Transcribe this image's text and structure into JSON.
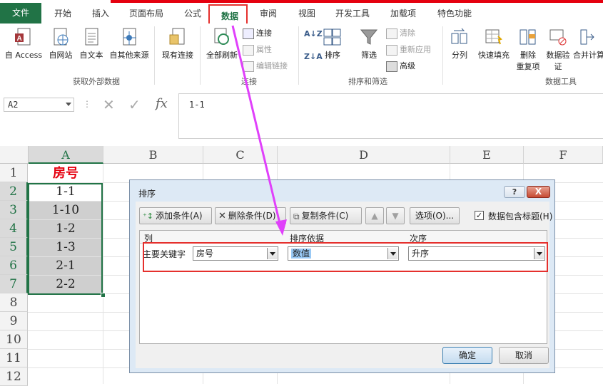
{
  "tabs": {
    "file": "文件",
    "items": [
      "开始",
      "插入",
      "页面布局",
      "公式",
      "数据",
      "审阅",
      "视图",
      "开发工具",
      "加载项",
      "特色功能"
    ],
    "active": "数据"
  },
  "ribbon": {
    "external": {
      "access": "自 Access",
      "web": "自网站",
      "text": "自文本",
      "other": "自其他来源",
      "existing": "现有连接",
      "group_label": "获取外部数据"
    },
    "connections": {
      "refresh_all": "全部刷新",
      "connections": "连接",
      "properties": "属性",
      "edit_links": "编辑链接",
      "group_label": "连接"
    },
    "sort_filter": {
      "sort_az": "A↓Z",
      "sort_za": "Z↓A",
      "sort": "排序",
      "filter": "筛选",
      "clear": "清除",
      "reapply": "重新应用",
      "advanced": "高级",
      "group_label": "排序和筛选"
    },
    "data_tools": {
      "split": "分列",
      "flash_fill": "快速填充",
      "remove_dup_1": "删除",
      "remove_dup_2": "重复项",
      "validation_1": "数据验",
      "validation_2": "证",
      "consolidate": "合并计算",
      "group_label": "数据工具"
    }
  },
  "formula_bar": {
    "name_box": "A2",
    "fx": "fx",
    "value": "1-1"
  },
  "sheet": {
    "columns": [
      "A",
      "B",
      "C",
      "D",
      "E",
      "F"
    ],
    "rows": [
      "1",
      "2",
      "3",
      "4",
      "5",
      "6",
      "7",
      "8",
      "9",
      "10",
      "11",
      "12"
    ],
    "column_a": [
      "房号",
      "1-1",
      "1-10",
      "1-2",
      "1-3",
      "2-1",
      "2-2"
    ]
  },
  "dialog": {
    "title": "排序",
    "help": "?",
    "close": "X",
    "add_level": "添加条件(A)",
    "delete_level": "删除条件(D)",
    "copy_level": "复制条件(C)",
    "options": "选项(O)...",
    "has_headers": "数据包含标题(H)",
    "has_headers_checked": true,
    "headers": {
      "column": "列",
      "sort_on": "排序依据",
      "order": "次序"
    },
    "row": {
      "label": "主要关键字",
      "column": "房号",
      "sort_on": "数值",
      "order": "升序"
    },
    "ok": "确定",
    "cancel": "取消"
  },
  "colors": {
    "excel_green": "#217346",
    "annotation_red": "#e5302d",
    "annotation_arrow": "#e040fb",
    "dialog_bg": "#dde9f5"
  }
}
